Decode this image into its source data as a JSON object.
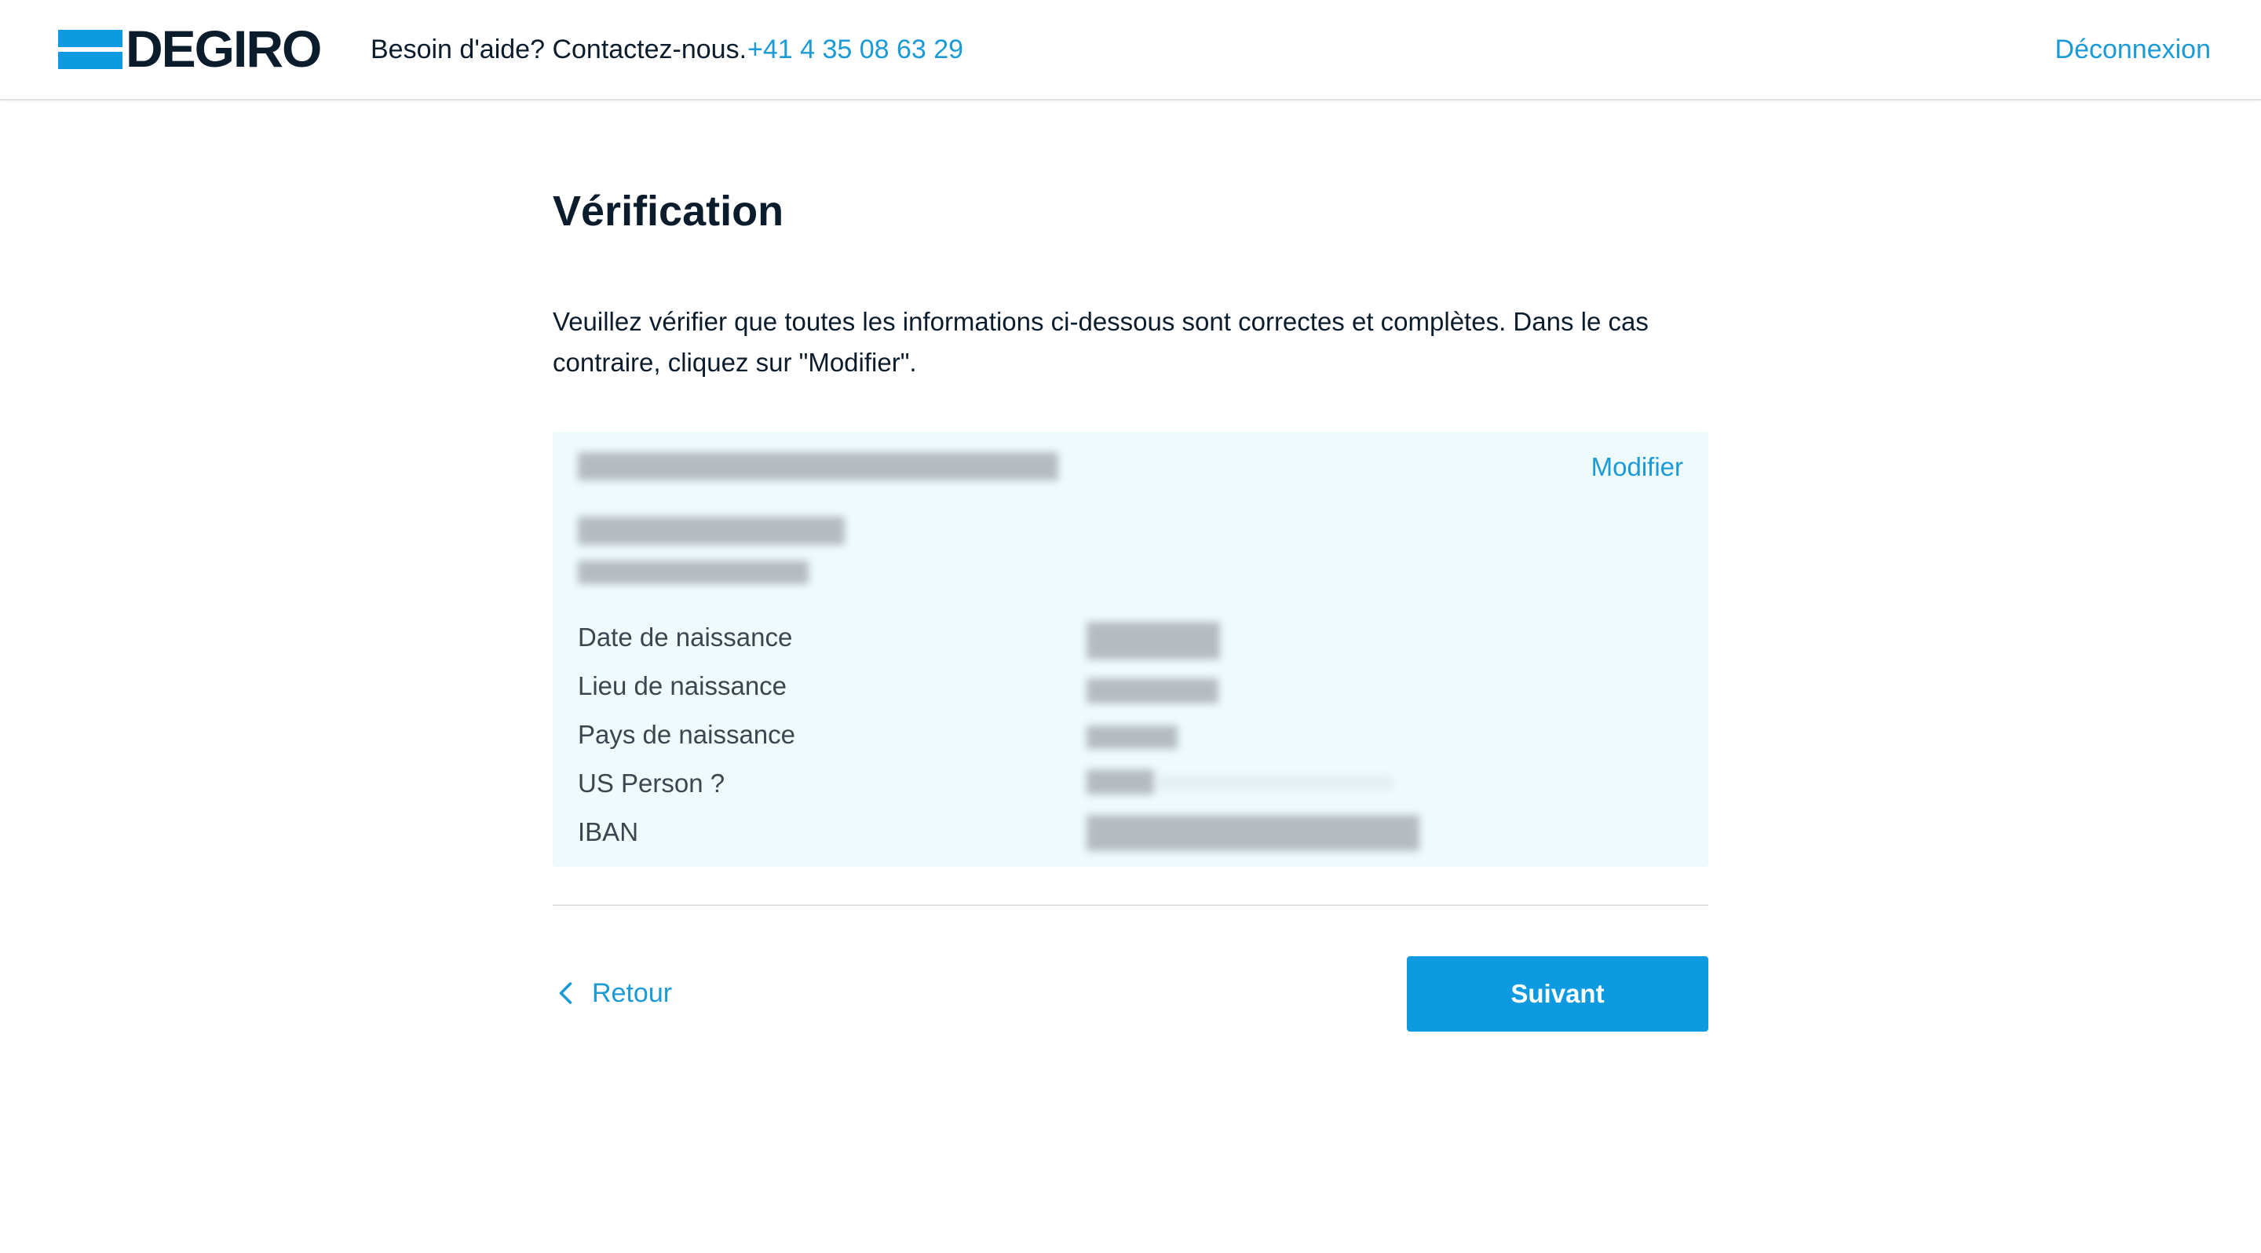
{
  "header": {
    "logo_text": "DEGIRO",
    "help_text": "Besoin d'aide? Contactez-nous.",
    "phone": "+41 4 35 08 63 29",
    "logout_label": "Déconnexion"
  },
  "main": {
    "title": "Vérification",
    "intro": "Veuillez vérifier que toutes les informations ci-dessous sont correctes et complètes. Dans le cas contraire, cliquez sur \"Modifier\".",
    "card": {
      "modify_label": "Modifier",
      "fields": [
        {
          "label": "Date de naissance"
        },
        {
          "label": "Lieu de naissance"
        },
        {
          "label": "Pays de naissance"
        },
        {
          "label": "US Person ?"
        },
        {
          "label": "IBAN"
        }
      ]
    },
    "back_label": "Retour",
    "next_label": "Suivant"
  },
  "colors": {
    "brand_blue": "#0d9ae0",
    "link_blue": "#1a9ad6",
    "card_bg": "#effafc"
  },
  "icons": {
    "back": "chevron-left-icon"
  }
}
